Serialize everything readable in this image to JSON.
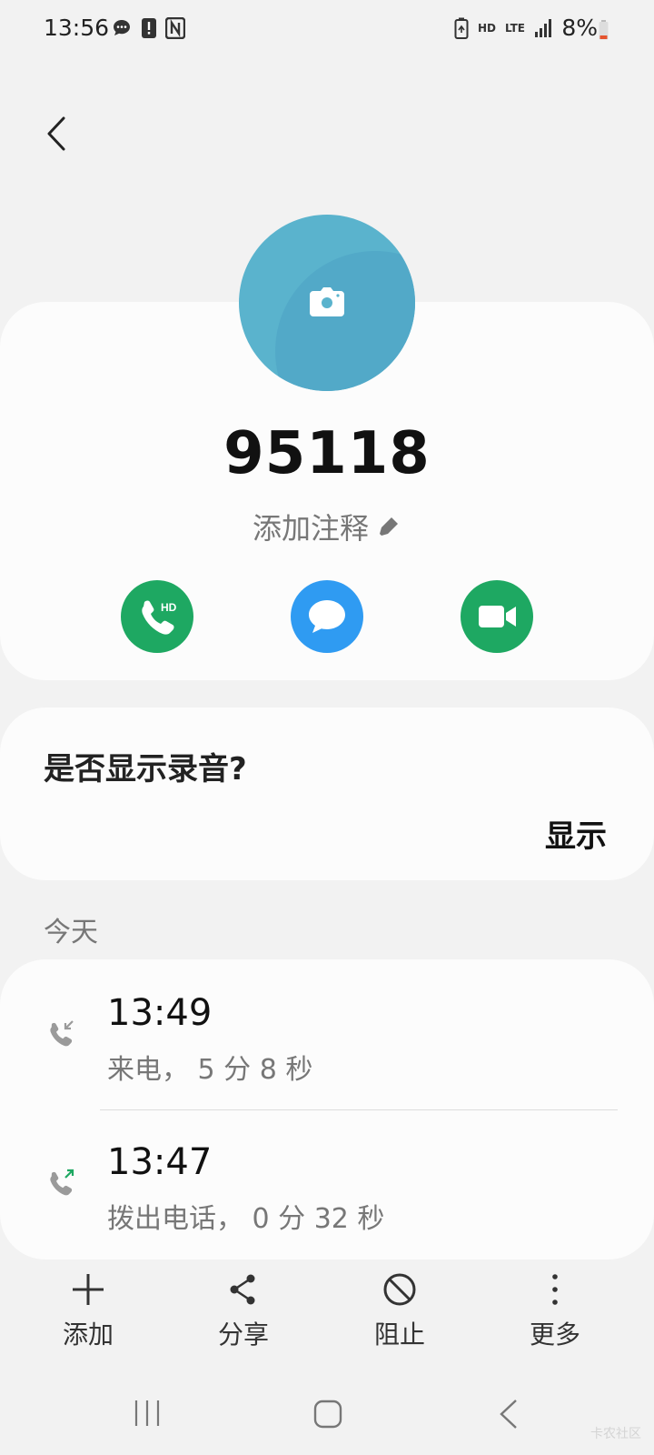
{
  "status_bar": {
    "time": "13:56",
    "battery_percent": "8%",
    "network": "LTE",
    "hd_label": "HD",
    "icons": [
      "chat-bubble-icon",
      "alert-icon",
      "nfc-icon",
      "battery-saver-icon",
      "hd-voice-icon",
      "lte-icon",
      "signal-icon",
      "battery-icon"
    ]
  },
  "contact": {
    "number": "95118",
    "add_note": "添加注释",
    "avatar_color": "#5ab3cd"
  },
  "actions": [
    {
      "name": "hd-call",
      "color": "#1ea862",
      "badge": "HD"
    },
    {
      "name": "message",
      "color": "#2f9bf2"
    },
    {
      "name": "video-call",
      "color": "#1ea862"
    }
  ],
  "recording_prompt": {
    "question": "是否显示录音?",
    "show_label": "显示"
  },
  "history": {
    "section_label": "今天",
    "entries": [
      {
        "time": "13:49",
        "detail": "来电， 5 分 8 秒",
        "type": "incoming"
      },
      {
        "time": "13:47",
        "detail": "拨出电话， 0 分 32 秒",
        "type": "outgoing"
      }
    ]
  },
  "bottom_bar": {
    "add": "添加",
    "share": "分享",
    "block": "阻止",
    "more": "更多"
  },
  "watermark": "卡农社区"
}
